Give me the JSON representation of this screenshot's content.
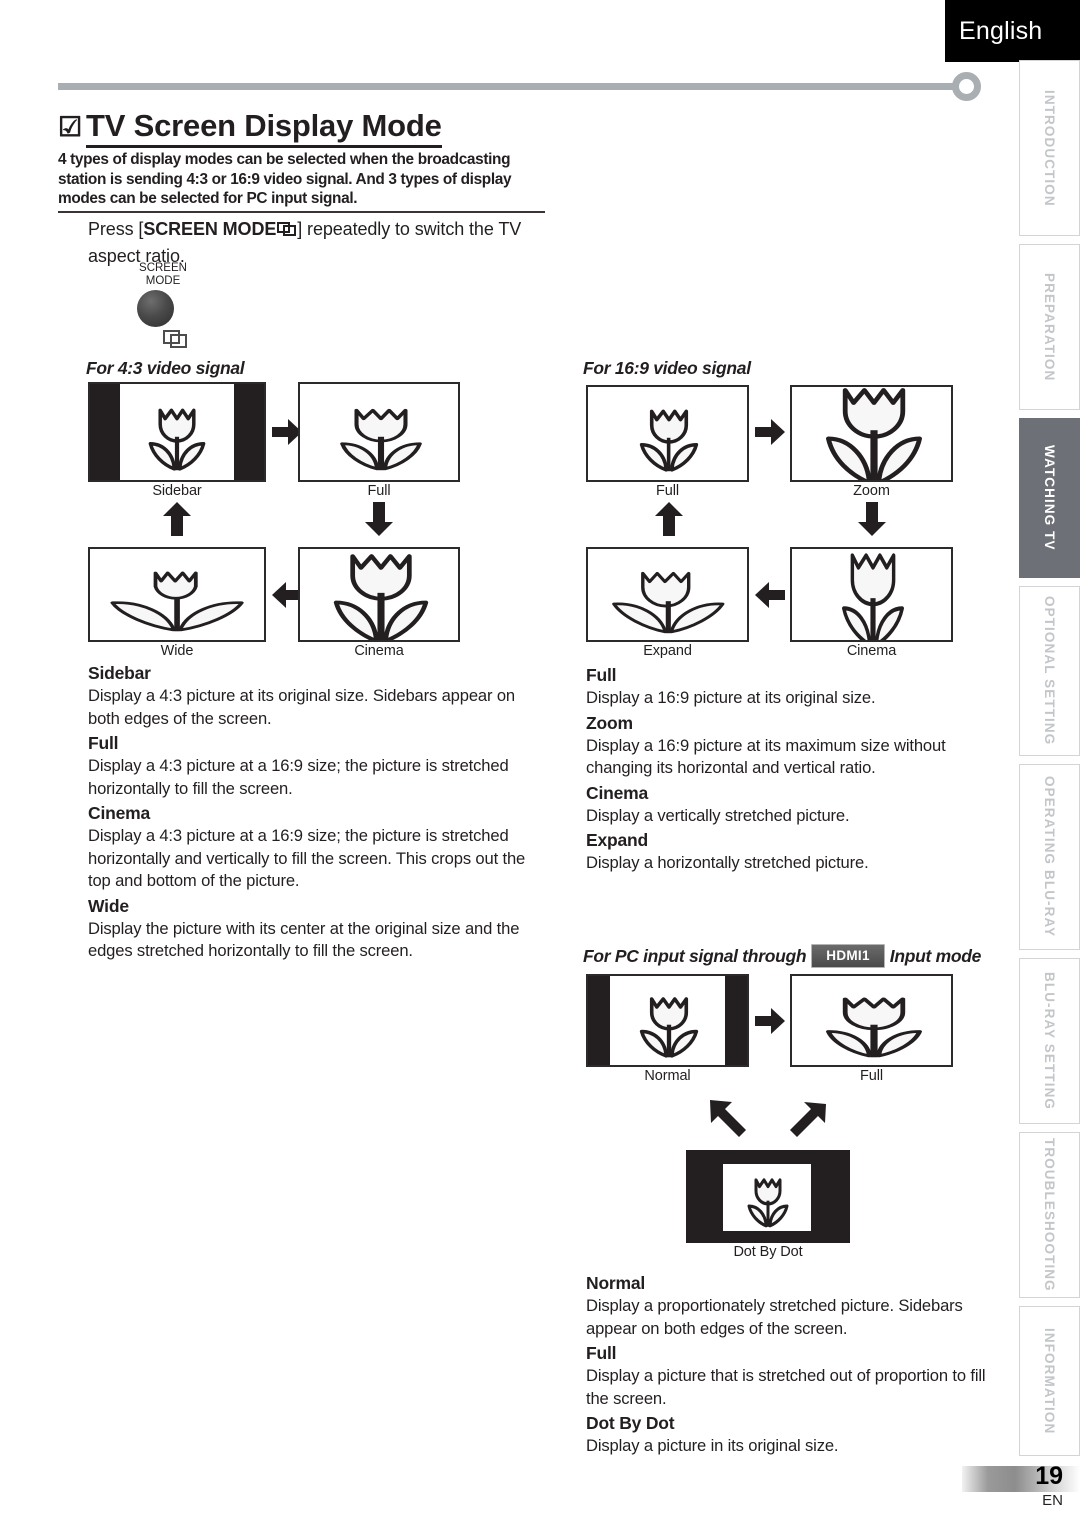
{
  "header": {
    "language": "English",
    "title": "TV Screen Display Mode",
    "title_check": "☑",
    "intro": "4 types of display modes can be selected when the broadcasting station is sending 4:3 or 16:9 video signal. And 3 types of display modes can be selected for PC input signal.",
    "press_pre": "Press [",
    "press_key": "SCREEN MODE",
    "press_post": "] repeatedly to switch the TV aspect ratio."
  },
  "remote": {
    "label_line1": "SCREEN",
    "label_line2": "MODE"
  },
  "sidebar_tabs": [
    {
      "label": "INTRODUCTION",
      "active": false
    },
    {
      "label": "PREPARATION",
      "active": false
    },
    {
      "label": "WATCHING  TV",
      "active": true
    },
    {
      "label": "OPTIONAL  SETTING",
      "active": false
    },
    {
      "label": "OPERATING  BLU-RAY",
      "active": false
    },
    {
      "label": "BLU-RAY  SETTING",
      "active": false
    },
    {
      "label": "TROUBLESHOOTING",
      "active": false
    },
    {
      "label": "INFORMATION",
      "active": false
    }
  ],
  "section_43": {
    "heading": "For 4:3 video signal",
    "boxes": {
      "sidebar": "Sidebar",
      "full": "Full",
      "wide": "Wide",
      "cinema": "Cinema"
    },
    "definitions": [
      {
        "term": "Sidebar",
        "desc": "Display a 4:3 picture at its original size. Sidebars appear on both edges of the screen."
      },
      {
        "term": "Full",
        "desc": "Display a 4:3 picture at a 16:9 size; the picture is stretched horizontally to fill the screen."
      },
      {
        "term": "Cinema",
        "desc": "Display a 4:3 picture at a 16:9 size; the picture is stretched horizontally and vertically to fill the screen. This crops out the top and bottom of the picture."
      },
      {
        "term": "Wide",
        "desc": "Display the picture with its center at the original size and the edges stretched horizontally to fill the screen."
      }
    ]
  },
  "section_169": {
    "heading": "For 16:9 video signal",
    "boxes": {
      "full": "Full",
      "zoom": "Zoom",
      "expand": "Expand",
      "cinema": "Cinema"
    },
    "definitions": [
      {
        "term": "Full",
        "desc": "Display a 16:9 picture at its original size."
      },
      {
        "term": "Zoom",
        "desc": "Display a 16:9 picture at its maximum size without changing its horizontal and vertical ratio."
      },
      {
        "term": "Cinema",
        "desc": "Display a vertically stretched picture."
      },
      {
        "term": "Expand",
        "desc": "Display a horizontally stretched picture."
      }
    ]
  },
  "section_pc": {
    "heading_pre": "For PC input signal through",
    "heading_badge": "HDMI1",
    "heading_post": "Input mode",
    "boxes": {
      "normal": "Normal",
      "full": "Full",
      "dotbydot": "Dot By Dot"
    },
    "definitions": [
      {
        "term": "Normal",
        "desc": "Display a proportionately stretched picture. Sidebars appear on both edges of the screen."
      },
      {
        "term": "Full",
        "desc": "Display a picture that is stretched out of proportion to fill the screen."
      },
      {
        "term": "Dot By Dot",
        "desc": "Display a picture in its original size."
      }
    ]
  },
  "footer": {
    "page_number": "19",
    "language_code": "EN"
  },
  "colors": {
    "accent_gray": "#a9aeb3",
    "active_tab": "#6d7076",
    "ink": "#231f20"
  }
}
